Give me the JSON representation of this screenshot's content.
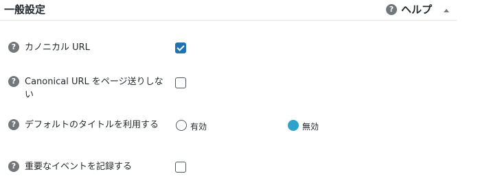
{
  "panel": {
    "title": "一般設定",
    "help_label": "ヘルプ"
  },
  "settings": [
    {
      "label": "カノニカル URL",
      "control": "checkbox",
      "checked": true
    },
    {
      "label": "Canonical URL をページ送りしない",
      "control": "checkbox",
      "checked": false
    },
    {
      "label": "デフォルトのタイトルを利用する",
      "control": "radio",
      "options": [
        {
          "label": "有効",
          "selected": false
        },
        {
          "label": "無効",
          "selected": true
        }
      ]
    },
    {
      "label": "重要なイベントを記録する",
      "control": "checkbox",
      "checked": false
    }
  ],
  "icons": {
    "help": "question-circle-icon",
    "collapse": "triangle-up-icon"
  },
  "colors": {
    "accent": "#2271b1",
    "radio_selected": "#2ea2cc",
    "icon_gray": "#72777c"
  }
}
